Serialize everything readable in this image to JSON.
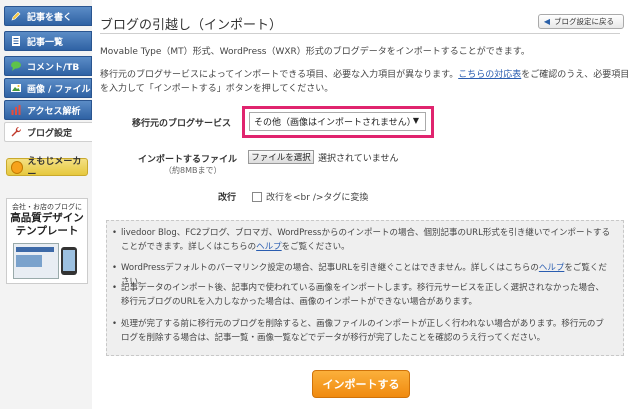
{
  "sidebar": {
    "items": [
      {
        "label": "記事を書く",
        "icon": "pencil-icon"
      },
      {
        "label": "記事一覧",
        "icon": "document-icon"
      },
      {
        "label": "コメント/TB",
        "icon": "speech-bubble-icon"
      },
      {
        "label": "画像 / ファイル",
        "icon": "image-icon"
      },
      {
        "label": "アクセス解析",
        "icon": "bar-chart-icon"
      },
      {
        "label": "ブログ設定",
        "icon": "wrench-icon"
      }
    ],
    "emoji_maker": "えもじメーカー",
    "banner": {
      "small": "会社・お店のブログに",
      "line1": "高品質デザイン",
      "line2": "テンプレート"
    }
  },
  "page": {
    "title": "ブログの引越し（インポート）",
    "back_button": "ブログ設定に戻る",
    "intro1": "Movable Type（MT）形式、WordPress（WXR）形式のブログデータをインポートすることができます。",
    "intro2_a": "移行元のブログサービスによってインポートできる項目、必要な入力項目が異なります。",
    "intro2_link": "こちらの対応表",
    "intro2_b": "をご確認のうえ、必要項目を入力して「インポートする」ボタンを押してください。"
  },
  "form": {
    "service_label": "移行元のブログサービス",
    "service_value": "その他（画像はインポートされません）",
    "file_label": "インポートするファイル",
    "file_sub": "（約8MBまで）",
    "file_button": "ファイルを選択",
    "file_status": "選択されていません",
    "br_label": "改行",
    "br_checkbox_label": "改行を<br />タグに変換"
  },
  "notes": [
    {
      "text": "livedoor Blog、FC2ブログ、ブロマガ、WordPressからのインポートの場合、個別記事のURL形式を引き継いでインポートすることができます。詳しくはこちらの",
      "link": "ヘルプ",
      "after": "をご覧ください。"
    },
    {
      "text": "WordPressデフォルトのパーマリンク設定の場合、記事URLを引き継ぐことはできません。詳しくはこちらの",
      "link": "ヘルプ",
      "after": "をご覧ください。"
    },
    {
      "text": "記事データのインポート後、記事内で使われている画像をインポートします。移行元サービスを正しく選択されなかった場合、移行元ブログのURLを入力しなかった場合は、画像のインポートができない場合があります。",
      "link": "",
      "after": ""
    },
    {
      "text": "処理が完了する前に移行元のブログを削除すると、画像ファイルのインポートが正しく行われない場合があります。移行元のブログを削除する場合は、記事一覧・画像一覧などでデータが移行が完了したことを確認のうえ行ってください。",
      "link": "",
      "after": ""
    }
  ],
  "import_button": "インポートする",
  "colors": {
    "nav_blue": "#2f62a4",
    "highlight": "#e0246e",
    "import_orange": "#f08a0f",
    "link": "#2a5db0"
  }
}
